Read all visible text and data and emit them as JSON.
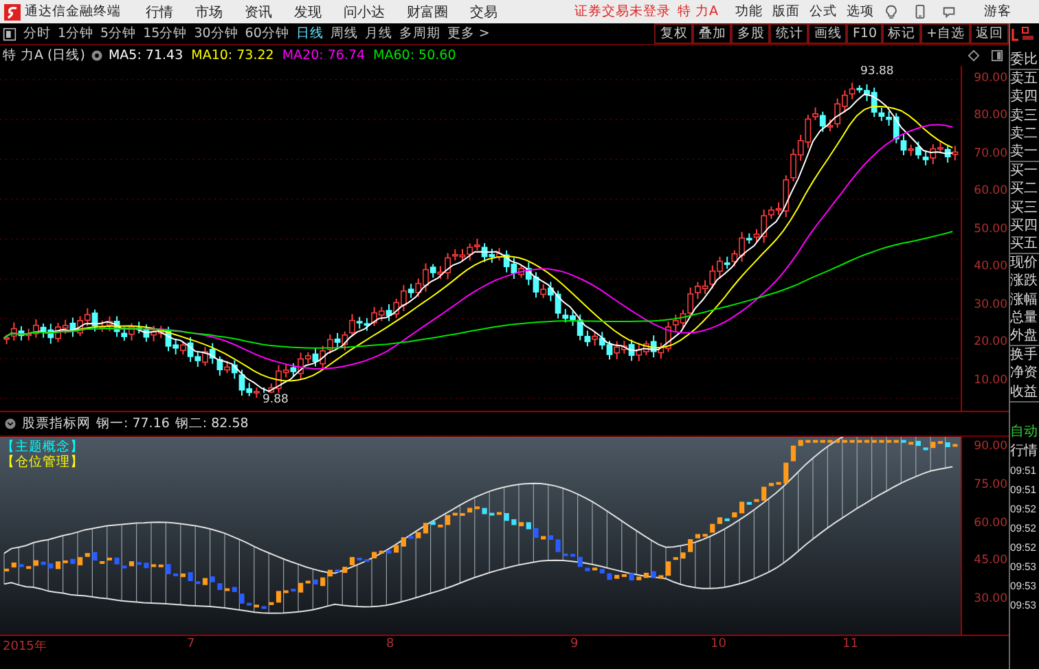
{
  "app_title": "通达信金融终端",
  "menu": [
    "行情",
    "市场",
    "资讯",
    "发现",
    "问小达",
    "财富圈",
    "交易"
  ],
  "login_notice": "证券交易未登录",
  "stock_name": "特 力A",
  "top_actions": [
    "功能",
    "版面",
    "公式",
    "选项"
  ],
  "user": "游客",
  "periods": [
    {
      "label": "分时",
      "selected": false
    },
    {
      "label": "1分钟",
      "selected": false
    },
    {
      "label": "5分钟",
      "selected": false
    },
    {
      "label": "15分钟",
      "selected": false
    },
    {
      "label": "30分钟",
      "selected": false
    },
    {
      "label": "60分钟",
      "selected": false
    },
    {
      "label": "日线",
      "selected": true
    },
    {
      "label": "周线",
      "selected": false
    },
    {
      "label": "月线",
      "selected": false
    },
    {
      "label": "多周期",
      "selected": false
    },
    {
      "label": "更多 >",
      "selected": false
    }
  ],
  "chart_buttons": [
    "复权",
    "叠加",
    "多股",
    "统计",
    "画线",
    "F10",
    "标记",
    "+自选",
    "返回"
  ],
  "main_chart": {
    "title": "特 力A (日线)",
    "indicators": [
      {
        "label": "MA5: 71.43",
        "color": "#ffffff"
      },
      {
        "label": "MA10: 73.22",
        "color": "#ffff00"
      },
      {
        "label": "MA20: 76.74",
        "color": "#ff00ff"
      },
      {
        "label": "MA60: 50.60",
        "color": "#00e600"
      }
    ],
    "high_label": "93.88",
    "low_label": "9.88",
    "y_axis": [
      "90.00",
      "80.00",
      "70.00",
      "60.00",
      "50.00",
      "40.00",
      "30.00",
      "20.00",
      "10.00"
    ]
  },
  "quote_groups": [
    [
      "委比"
    ],
    [
      "卖五",
      "卖四",
      "卖三",
      "卖二",
      "卖一"
    ],
    [
      "买一",
      "买二",
      "买三",
      "买四",
      "买五"
    ],
    [
      "现价",
      "涨跌",
      "涨幅",
      "总量",
      "外盘"
    ],
    [
      "换手",
      "净资",
      "收益"
    ]
  ],
  "indicator_panel": {
    "title": "股票指标网",
    "values": [
      "钢一: 77.16",
      "钢二: 82.58"
    ],
    "tags": [
      {
        "label": "【主题概念】",
        "color": "#00ffff"
      },
      {
        "label": "【仓位管理】",
        "color": "#ffff00"
      }
    ],
    "y_axis": [
      "90.00",
      "75.00",
      "60.00",
      "45.00",
      "30.00"
    ]
  },
  "side_buttons": [
    {
      "label": "自动",
      "kind": "mode"
    },
    {
      "label": "行情",
      "kind": "tab"
    }
  ],
  "times": [
    "09:51",
    "09:51",
    "09:52",
    "09:52",
    "09:52",
    "09:53",
    "09:53",
    "09:53"
  ],
  "date_axis": [
    "2015年",
    "7",
    "8",
    "9",
    "10",
    "11"
  ]
}
